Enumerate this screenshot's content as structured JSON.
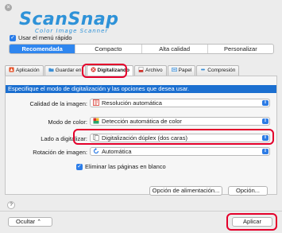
{
  "app": {
    "logo_main": "ScanSnap",
    "logo_sub": "Color Image Scanner"
  },
  "quick_menu": {
    "checked": true,
    "label": "Usar el menú rápido"
  },
  "profiles": [
    {
      "label": "Recomendada",
      "selected": true
    },
    {
      "label": "Compacto",
      "selected": false
    },
    {
      "label": "Alta calidad",
      "selected": false
    },
    {
      "label": "Personalizar",
      "selected": false
    }
  ],
  "tabs": [
    {
      "label": "Aplicación",
      "icon": "app-icon",
      "color": "#e5532a"
    },
    {
      "label": "Guardar en",
      "icon": "folder-icon",
      "color": "#3c8fd6"
    },
    {
      "label": "Digitalizando",
      "icon": "scan-icon",
      "color": "#d6322a",
      "active": true
    },
    {
      "label": "Archivo",
      "icon": "file-icon",
      "color": "#d6322a"
    },
    {
      "label": "Papel",
      "icon": "paper-icon",
      "color": "#3c8fd6"
    },
    {
      "label": "Compresión",
      "icon": "compress-icon",
      "color": "#3c8fd6"
    }
  ],
  "instruction": "Especifique el modo de digitalización y las opciones que desea usar.",
  "settings": [
    {
      "label": "Calidad de la imagen:",
      "value": "Resolución automática",
      "icon_color": "#d6322a"
    },
    {
      "label": "Modo de color:",
      "value": "Detección automática de color",
      "icon_color": "#2aa56a"
    },
    {
      "label": "Lado a digitalizar:",
      "value": "Digitalización dúplex (dos caras)",
      "icon_color": "#8a8a8a"
    },
    {
      "label": "Rotación de imagen:",
      "value": "Automática",
      "icon_color": "#2c7be5"
    }
  ],
  "remove_blank": {
    "checked": true,
    "label": "Eliminar las páginas en blanco"
  },
  "buttons": {
    "feed_option": "Opción de alimentación...",
    "option": "Opción...",
    "help": "?",
    "hide": "Ocultar",
    "hide_arrow": "⌃",
    "apply": "Aplicar"
  },
  "colors": {
    "accent": "#2f86ef",
    "highlight": "#e4002b",
    "instruction_bar": "#1b6fd0"
  }
}
